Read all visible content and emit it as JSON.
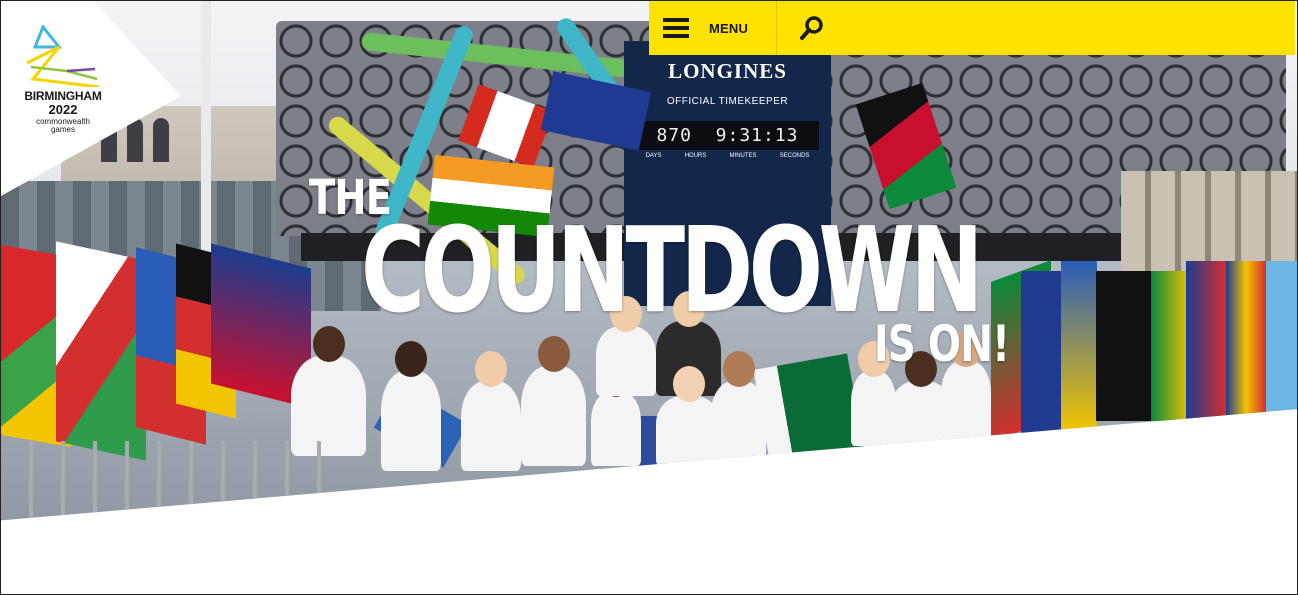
{
  "logo": {
    "line1": "BIRMINGHAM",
    "line2": "2022",
    "line3": "commonwealth",
    "line4": "games",
    "colors": [
      "#3fb7e0",
      "#f5d400",
      "#8dc63f",
      "#7b4aa3"
    ]
  },
  "nav": {
    "menu_label": "MENU",
    "menu_icon": "hamburger-icon",
    "search_icon": "search-icon",
    "bar_color": "#ffe200"
  },
  "hero": {
    "headline_line1": "THE",
    "headline_line2": "COUNTDOWN",
    "headline_line3": "IS ON!",
    "clock": {
      "brand": "LONGINES",
      "subtitle": "OFFICIAL TIMEKEEPER",
      "digits": "870  9:31:13",
      "units": [
        "DAYS",
        "HOURS",
        "MINUTES",
        "SECONDS"
      ]
    }
  }
}
